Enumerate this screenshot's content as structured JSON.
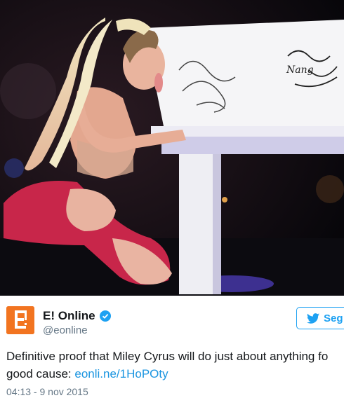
{
  "tweet": {
    "display_name": "E! Online",
    "handle": "@eonline",
    "verified_icon": "verified-badge-icon",
    "follow_label": "Seg",
    "text_line1": "Definitive proof that Miley Cyrus will do just about anything fo",
    "text_line2_prefix": "good cause: ",
    "link_text": "eonli.ne/1HoPOty",
    "timestamp": "04:13 - 9 nov 2015",
    "avatar_letter": "E!"
  },
  "photo": {
    "signature_left": "...",
    "signature_right": "Nang"
  },
  "colors": {
    "avatar_bg": "#f27420",
    "link": "#1b95e0",
    "follow_border": "#1da1f2"
  }
}
